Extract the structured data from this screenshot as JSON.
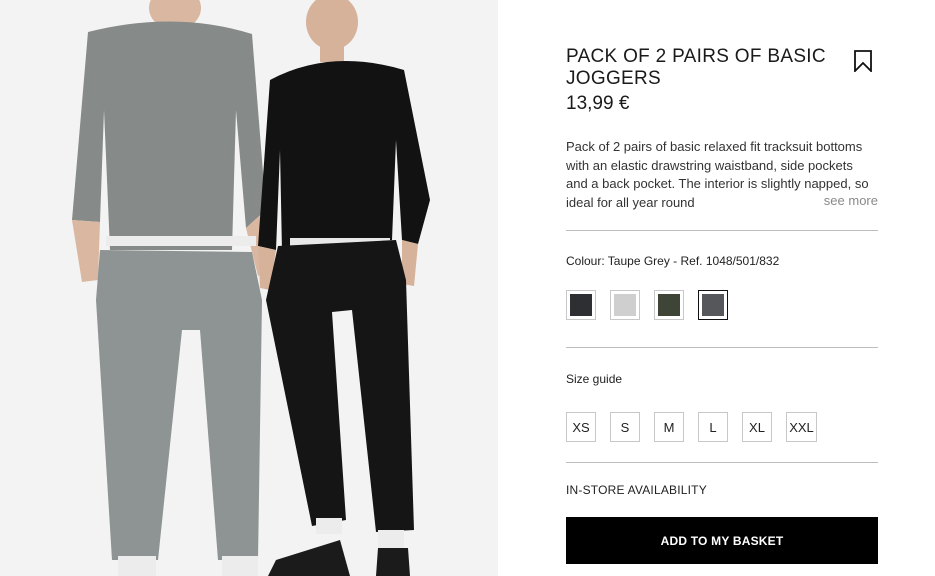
{
  "product": {
    "title": "PACK OF 2 PAIRS OF BASIC JOGGERS",
    "price": "13,99 €",
    "description": "Pack of 2 pairs of basic relaxed fit tracksuit bottoms with an elastic drawstring waistband, side pockets and a back pocket. The interior is slightly napped, so ideal for all year round",
    "see_more": "see more"
  },
  "colour": {
    "label": "Colour: Taupe Grey - Ref. 1048/501/832",
    "swatches": [
      {
        "name": "charcoal",
        "color": "#2e2f33"
      },
      {
        "name": "light-grey",
        "color": "#cfcfcf"
      },
      {
        "name": "khaki",
        "color": "#3e4536"
      },
      {
        "name": "taupe-grey",
        "color": "#55575b",
        "selected": true
      }
    ]
  },
  "sizes": {
    "guide_label": "Size guide",
    "options": [
      "XS",
      "S",
      "M",
      "L",
      "XL",
      "XXL"
    ]
  },
  "availability_label": "IN-STORE AVAILABILITY",
  "basket_label": "ADD TO MY BASKET"
}
